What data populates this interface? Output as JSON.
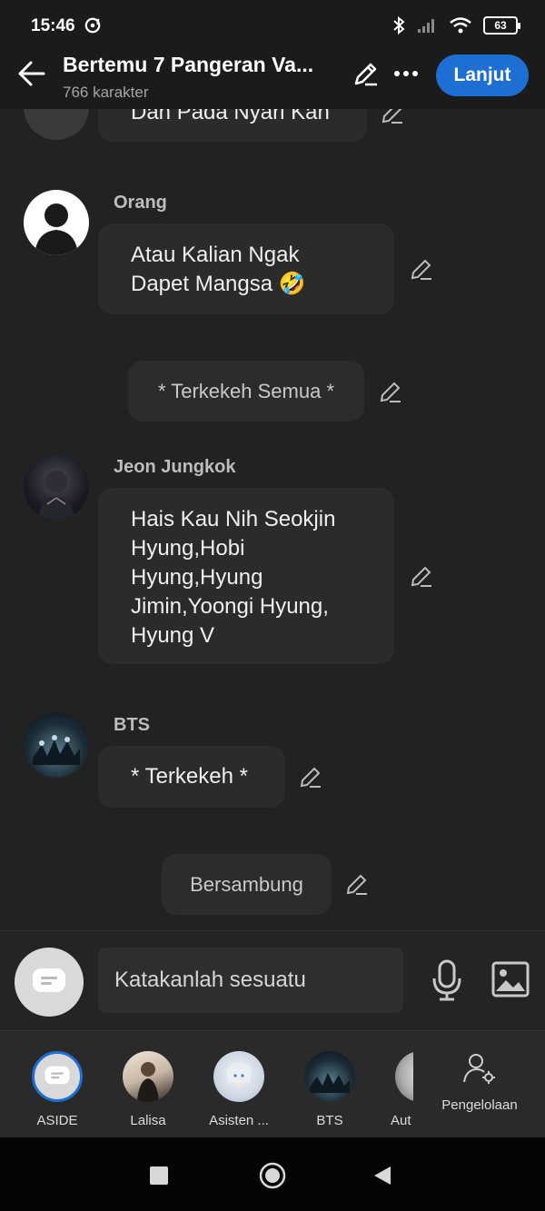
{
  "status_bar": {
    "time": "15:46",
    "battery": "63"
  },
  "header": {
    "title": "Bertemu 7 Pangeran Va...",
    "subtitle": "766 karakter",
    "continue_label": "Lanjut",
    "accent_color": "#1d6fd3"
  },
  "chat": {
    "partial_message": "Dan Pada Nyari Kan",
    "messages": [
      {
        "sender": "Orang",
        "text": "Atau Kalian Ngak Dapet Mangsa 🤣"
      },
      {
        "narration": "* Terkekeh Semua *"
      },
      {
        "sender": "Jeon Jungkok",
        "text": "Hais Kau Nih Seokjin Hyung,Hobi Hyung,Hyung Jimin,Yoongi Hyung, Hyung V"
      },
      {
        "sender": "BTS",
        "text": "* Terkekeh *"
      },
      {
        "narration": "Bersambung"
      }
    ]
  },
  "input": {
    "placeholder": "Katakanlah sesuatu"
  },
  "characters": [
    {
      "label": "ASIDE"
    },
    {
      "label": "Lalisa"
    },
    {
      "label": "Asisten ..."
    },
    {
      "label": "BTS"
    },
    {
      "label": "Aut"
    }
  ],
  "manage_label": "Pengelolaan",
  "icons": {
    "back": "arrow-left-icon",
    "edit": "pencil-icon",
    "more": "more-dots-icon",
    "mic": "microphone-icon",
    "image": "image-icon",
    "manage": "user-gear-icon"
  }
}
